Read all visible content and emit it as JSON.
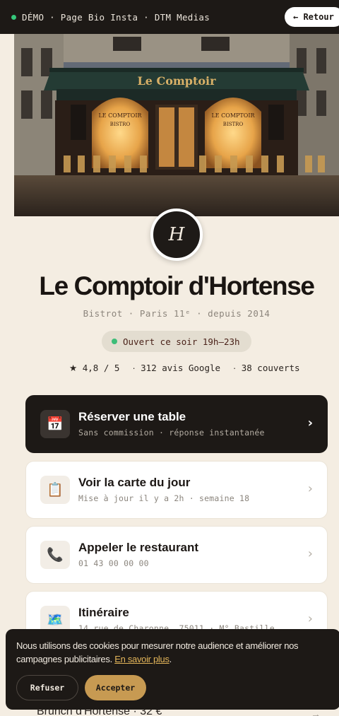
{
  "topbar": {
    "label": "DÉMO · Page Bio Insta · DTM Medias",
    "back_label": "← Retour"
  },
  "hero": {
    "sign_text": "Le Comptoir",
    "window_text": "LE COMPTOIR",
    "window_sub": "BISTRO"
  },
  "profile": {
    "avatar_letter": "H",
    "name": "Le Comptoir d'Hortense",
    "subtitle": "Bistrot · Paris 11ᵉ · depuis 2014",
    "status": "Ouvert ce soir 19h–23h"
  },
  "stats": [
    {
      "icon": "★",
      "text": "4,8 / 5"
    },
    {
      "icon": "·",
      "text": "312 avis Google"
    },
    {
      "icon": "·",
      "text": "38 couverts"
    }
  ],
  "links": [
    {
      "icon": "📅",
      "title": "Réserver une table",
      "sub": "Sans commission · réponse instantanée",
      "chevron": "›"
    },
    {
      "icon": "📋",
      "title": "Voir la carte du jour",
      "sub": "Mise à jour il y a 2h · semaine 18",
      "chevron": "›"
    },
    {
      "icon": "📞",
      "title": "Appeler le restaurant",
      "sub": "01 43 00 00 00",
      "chevron": "›"
    },
    {
      "icon": "🗺️",
      "title": "Itinéraire",
      "sub": "14 rue de Charonne, 75011 · M° Bastille",
      "chevron": "›"
    }
  ],
  "peek": {
    "text": "Brunch d'Hortense · 32 €",
    "arrow": "→"
  },
  "cookie": {
    "text": "Nous utilisons des cookies pour mesurer notre audience et améliorer nos campagnes publicitaires.",
    "link": "En savoir plus",
    "period": ".",
    "refuse": "Refuser",
    "accept": "Accepter"
  },
  "colors": {
    "background": "#f4ede2",
    "dark": "#1d1916",
    "accent_gold": "#c79a52",
    "status_green": "#35c77b"
  }
}
